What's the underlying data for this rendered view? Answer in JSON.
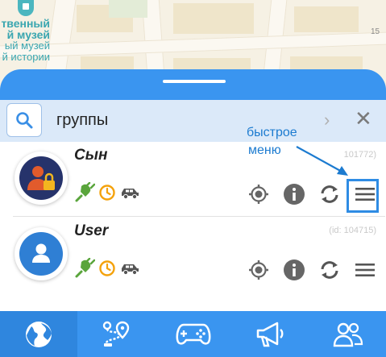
{
  "map": {
    "museum_lines": [
      "твенный",
      "й музей",
      "ый музей",
      "й истории"
    ],
    "number": "15"
  },
  "search": {
    "query": "группы"
  },
  "objects": [
    {
      "name": "Сын",
      "id": "101772)"
    },
    {
      "name": "User",
      "id": "(id: 104715)"
    }
  ],
  "annotation": {
    "quick_menu_line1": "быстрое",
    "quick_menu_line2": "меню"
  },
  "colors": {
    "accent": "#3a95f0",
    "search_bg": "#dbe9f9",
    "online_green": "#5aa53c",
    "clock_orange": "#f4a20c"
  }
}
